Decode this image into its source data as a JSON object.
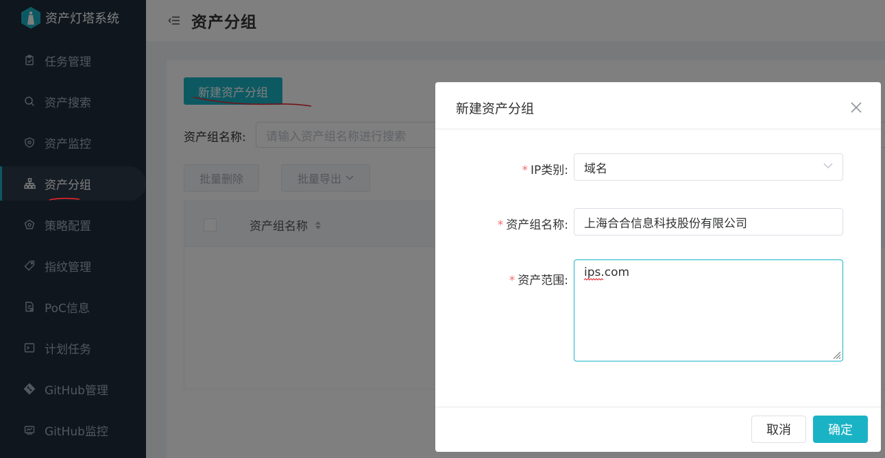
{
  "app": {
    "title": "资产灯塔系统"
  },
  "sidebar": {
    "items": [
      {
        "label": "任务管理",
        "icon": "clipboard-icon"
      },
      {
        "label": "资产搜索",
        "icon": "search-icon"
      },
      {
        "label": "资产监控",
        "icon": "shield-icon"
      },
      {
        "label": "资产分组",
        "icon": "sitemap-icon",
        "active": true
      },
      {
        "label": "策略配置",
        "icon": "pentagon-icon"
      },
      {
        "label": "指纹管理",
        "icon": "tag-icon"
      },
      {
        "label": "PoC信息",
        "icon": "document-icon"
      },
      {
        "label": "计划任务",
        "icon": "terminal-icon"
      },
      {
        "label": "GitHub管理",
        "icon": "git-icon"
      },
      {
        "label": "GitHub监控",
        "icon": "monitor-icon"
      }
    ]
  },
  "header": {
    "title": "资产分组"
  },
  "main": {
    "new_button": "新建资产分组",
    "search_label": "资产组名称:",
    "search_placeholder": "请输入资产组名称进行搜索",
    "batch_delete": "批量删除",
    "batch_export": "批量导出",
    "table": {
      "columns": [
        "资产组名称"
      ]
    }
  },
  "dialog": {
    "title": "新建资产分组",
    "fields": {
      "ip_type": {
        "label": "IP类别:",
        "value": "域名"
      },
      "group_name": {
        "label": "资产组名称:",
        "value": "上海合合信息科技股份有限公司"
      },
      "asset_range": {
        "label": "资产范围:",
        "value": "ips.com"
      }
    },
    "cancel": "取消",
    "confirm": "确定"
  },
  "colors": {
    "accent": "#1ab3c5",
    "sidebar_bg": "#1f2d3d",
    "required": "#f56c6c"
  }
}
